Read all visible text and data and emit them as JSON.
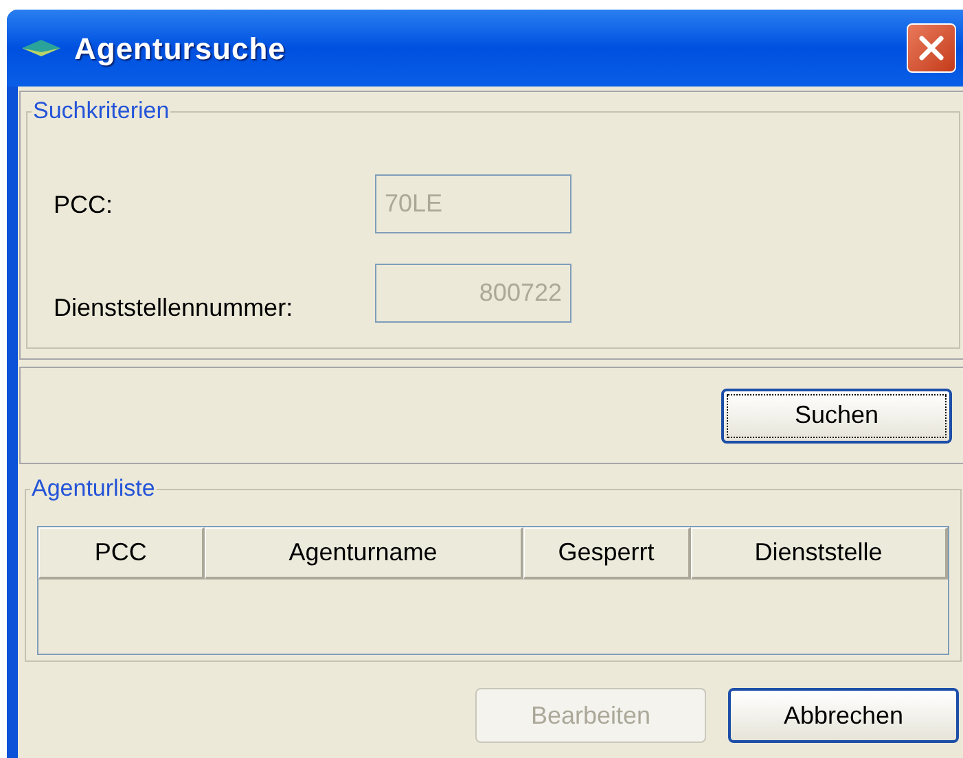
{
  "window": {
    "title": "Agentursuche"
  },
  "search_criteria": {
    "legend": "Suchkriterien",
    "fields": [
      {
        "label": "PCC:",
        "value": "70LE",
        "disabled": true,
        "kind": "text"
      },
      {
        "label": "Dienststellennummer:",
        "value": "800722",
        "disabled": true,
        "kind": "number"
      }
    ]
  },
  "search_button": {
    "label": "Suchen",
    "focused": true
  },
  "agent_list": {
    "legend": "Agenturliste",
    "columns": [
      "PCC",
      "Agenturname",
      "Gesperrt",
      "Dienststelle"
    ]
  },
  "buttons": [
    {
      "label": "Bearbeiten",
      "disabled": true
    },
    {
      "label": "Abbrechen",
      "disabled": false
    }
  ]
}
